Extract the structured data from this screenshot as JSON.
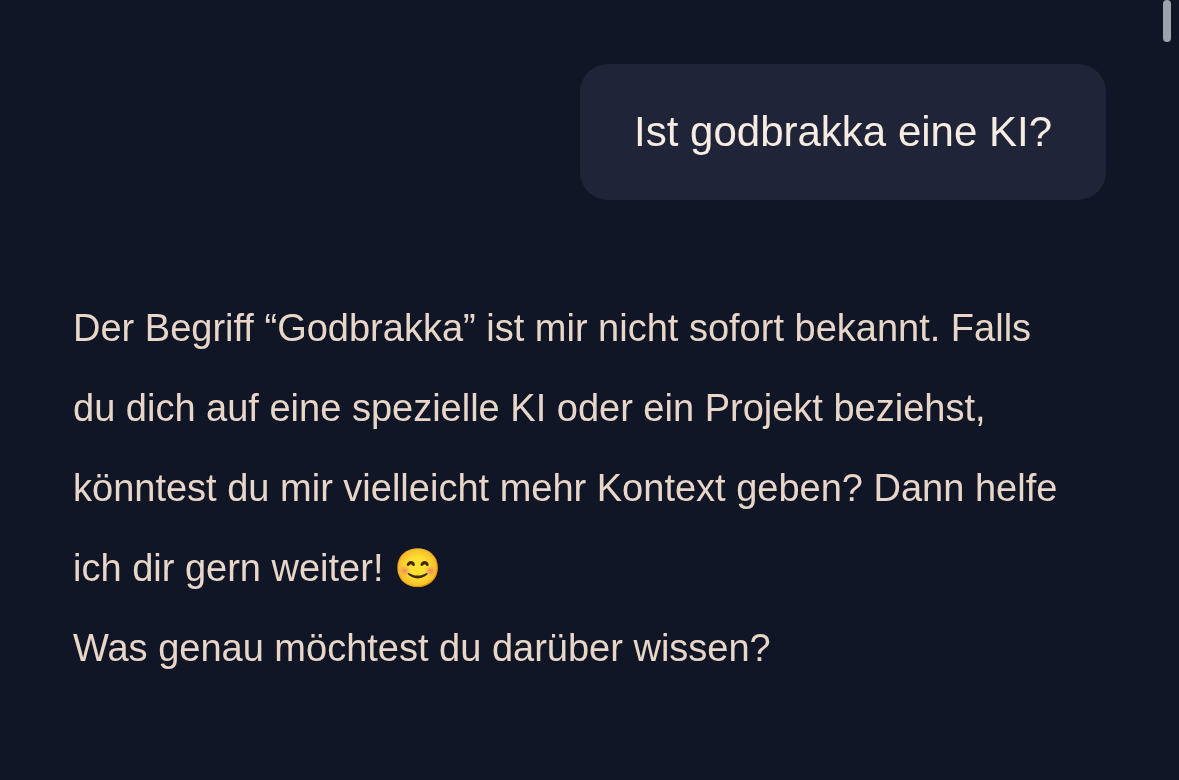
{
  "messages": [
    {
      "kind": "user",
      "text": "Ist godbrakka eine KI?"
    },
    {
      "kind": "assistant",
      "paragraphs": [
        "Der Begriff “Godbrakka” ist mir nicht sofort bekannt. Falls du dich auf eine spezielle KI oder ein Projekt beziehst, könntest du mir vielleicht mehr Kontext geben? Dann helfe ich dir gern weiter! 😊",
        "Was genau möchtest du darüber wissen?"
      ]
    }
  ]
}
